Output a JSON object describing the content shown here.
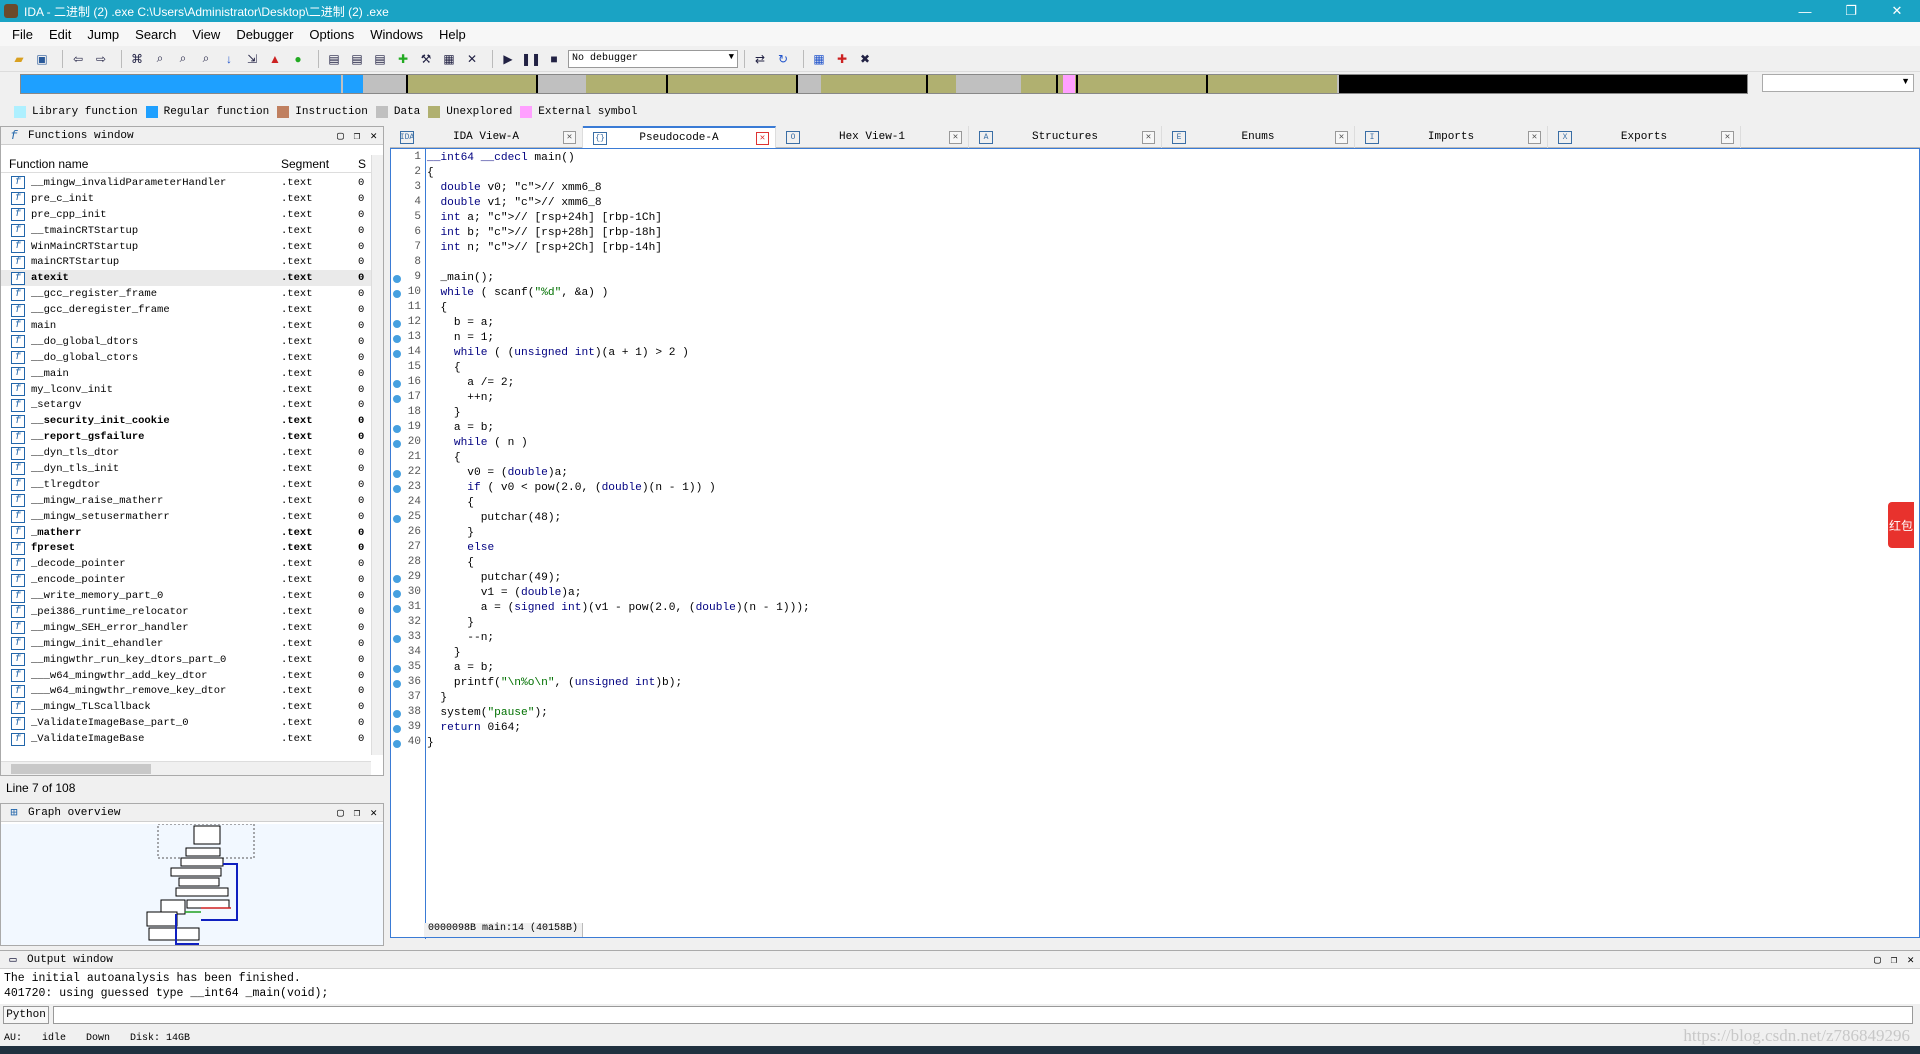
{
  "titlebar": {
    "title": "IDA - 二进制 (2) .exe C:\\Users\\Administrator\\Desktop\\二进制 (2) .exe",
    "min": "—",
    "max": "❐",
    "close": "✕"
  },
  "menu": [
    "File",
    "Edit",
    "Jump",
    "Search",
    "View",
    "Debugger",
    "Options",
    "Windows",
    "Help"
  ],
  "toolbar": {
    "debugger": "No debugger"
  },
  "legend": [
    {
      "label": "Library function",
      "color": "#aef0ff"
    },
    {
      "label": "Regular function",
      "color": "#1ea0ff"
    },
    {
      "label": "Instruction",
      "color": "#c08060"
    },
    {
      "label": "Data",
      "color": "#c0c0c0"
    },
    {
      "label": "Unexplored",
      "color": "#b0b070"
    },
    {
      "label": "External symbol",
      "color": "#ffa0ff"
    }
  ],
  "functions_window": {
    "title": "Functions window",
    "col_name": "Function name",
    "col_segment": "Segment",
    "col_start": "S",
    "rows": [
      {
        "name": "__mingw_invalidParameterHandler",
        "seg": ".text",
        "st": "0",
        "bold": false
      },
      {
        "name": "pre_c_init",
        "seg": ".text",
        "st": "0",
        "bold": false
      },
      {
        "name": "pre_cpp_init",
        "seg": ".text",
        "st": "0",
        "bold": false
      },
      {
        "name": "__tmainCRTStartup",
        "seg": ".text",
        "st": "0",
        "bold": false
      },
      {
        "name": "WinMainCRTStartup",
        "seg": ".text",
        "st": "0",
        "bold": false
      },
      {
        "name": "mainCRTStartup",
        "seg": ".text",
        "st": "0",
        "bold": false
      },
      {
        "name": "atexit",
        "seg": ".text",
        "st": "0",
        "bold": true
      },
      {
        "name": "__gcc_register_frame",
        "seg": ".text",
        "st": "0",
        "bold": false
      },
      {
        "name": "__gcc_deregister_frame",
        "seg": ".text",
        "st": "0",
        "bold": false
      },
      {
        "name": "main",
        "seg": ".text",
        "st": "0",
        "bold": false
      },
      {
        "name": "__do_global_dtors",
        "seg": ".text",
        "st": "0",
        "bold": false
      },
      {
        "name": "__do_global_ctors",
        "seg": ".text",
        "st": "0",
        "bold": false
      },
      {
        "name": "__main",
        "seg": ".text",
        "st": "0",
        "bold": false
      },
      {
        "name": "my_lconv_init",
        "seg": ".text",
        "st": "0",
        "bold": false
      },
      {
        "name": "_setargv",
        "seg": ".text",
        "st": "0",
        "bold": false
      },
      {
        "name": "__security_init_cookie",
        "seg": ".text",
        "st": "0",
        "bold": true
      },
      {
        "name": "__report_gsfailure",
        "seg": ".text",
        "st": "0",
        "bold": true
      },
      {
        "name": "__dyn_tls_dtor",
        "seg": ".text",
        "st": "0",
        "bold": false
      },
      {
        "name": "__dyn_tls_init",
        "seg": ".text",
        "st": "0",
        "bold": false
      },
      {
        "name": "__tlregdtor",
        "seg": ".text",
        "st": "0",
        "bold": false
      },
      {
        "name": "__mingw_raise_matherr",
        "seg": ".text",
        "st": "0",
        "bold": false
      },
      {
        "name": "__mingw_setusermatherr",
        "seg": ".text",
        "st": "0",
        "bold": false
      },
      {
        "name": "_matherr",
        "seg": ".text",
        "st": "0",
        "bold": true
      },
      {
        "name": "fpreset",
        "seg": ".text",
        "st": "0",
        "bold": true
      },
      {
        "name": "_decode_pointer",
        "seg": ".text",
        "st": "0",
        "bold": false
      },
      {
        "name": "_encode_pointer",
        "seg": ".text",
        "st": "0",
        "bold": false
      },
      {
        "name": "__write_memory_part_0",
        "seg": ".text",
        "st": "0",
        "bold": false
      },
      {
        "name": "_pei386_runtime_relocator",
        "seg": ".text",
        "st": "0",
        "bold": false
      },
      {
        "name": "__mingw_SEH_error_handler",
        "seg": ".text",
        "st": "0",
        "bold": false
      },
      {
        "name": "__mingw_init_ehandler",
        "seg": ".text",
        "st": "0",
        "bold": false
      },
      {
        "name": "__mingwthr_run_key_dtors_part_0",
        "seg": ".text",
        "st": "0",
        "bold": false
      },
      {
        "name": "___w64_mingwthr_add_key_dtor",
        "seg": ".text",
        "st": "0",
        "bold": false
      },
      {
        "name": "___w64_mingwthr_remove_key_dtor",
        "seg": ".text",
        "st": "0",
        "bold": false
      },
      {
        "name": "__mingw_TLScallback",
        "seg": ".text",
        "st": "0",
        "bold": false
      },
      {
        "name": "_ValidateImageBase_part_0",
        "seg": ".text",
        "st": "0",
        "bold": false
      },
      {
        "name": "_ValidateImageBase",
        "seg": ".text",
        "st": "0",
        "bold": false
      }
    ]
  },
  "line_count": "Line 7 of 108",
  "graph_overview": {
    "title": "Graph overview"
  },
  "tabs": [
    {
      "label": "IDA View-A",
      "icon": "IDA",
      "active": false
    },
    {
      "label": "Pseudocode-A",
      "icon": "{}",
      "active": true
    },
    {
      "label": "Hex View-1",
      "icon": "O",
      "active": false
    },
    {
      "label": "Structures",
      "icon": "A",
      "active": false
    },
    {
      "label": "Enums",
      "icon": "E",
      "active": false
    },
    {
      "label": "Imports",
      "icon": "I",
      "active": false
    },
    {
      "label": "Exports",
      "icon": "X",
      "active": false
    }
  ],
  "code_lines": [
    {
      "n": "1",
      "dot": false,
      "t": "__int64 __cdecl main()"
    },
    {
      "n": "2",
      "dot": false,
      "t": "{"
    },
    {
      "n": "3",
      "dot": false,
      "t": "  double v0; // xmm6_8"
    },
    {
      "n": "4",
      "dot": false,
      "t": "  double v1; // xmm6_8"
    },
    {
      "n": "5",
      "dot": false,
      "t": "  int a; // [rsp+24h] [rbp-1Ch]"
    },
    {
      "n": "6",
      "dot": false,
      "t": "  int b; // [rsp+28h] [rbp-18h]"
    },
    {
      "n": "7",
      "dot": false,
      "t": "  int n; // [rsp+2Ch] [rbp-14h]"
    },
    {
      "n": "8",
      "dot": false,
      "t": ""
    },
    {
      "n": "9",
      "dot": true,
      "t": "  _main();"
    },
    {
      "n": "10",
      "dot": true,
      "t": "  while ( scanf(\"%d\", &a) )"
    },
    {
      "n": "11",
      "dot": false,
      "t": "  {"
    },
    {
      "n": "12",
      "dot": true,
      "t": "    b = a;"
    },
    {
      "n": "13",
      "dot": true,
      "t": "    n = 1;"
    },
    {
      "n": "14",
      "dot": true,
      "t": "    while ( (unsigned int)(a + 1) > 2 )"
    },
    {
      "n": "15",
      "dot": false,
      "t": "    {"
    },
    {
      "n": "16",
      "dot": true,
      "t": "      a /= 2;"
    },
    {
      "n": "17",
      "dot": true,
      "t": "      ++n;"
    },
    {
      "n": "18",
      "dot": false,
      "t": "    }"
    },
    {
      "n": "19",
      "dot": true,
      "t": "    a = b;"
    },
    {
      "n": "20",
      "dot": true,
      "t": "    while ( n )"
    },
    {
      "n": "21",
      "dot": false,
      "t": "    {"
    },
    {
      "n": "22",
      "dot": true,
      "t": "      v0 = (double)a;"
    },
    {
      "n": "23",
      "dot": true,
      "t": "      if ( v0 < pow(2.0, (double)(n - 1)) )"
    },
    {
      "n": "24",
      "dot": false,
      "t": "      {"
    },
    {
      "n": "25",
      "dot": true,
      "t": "        putchar(48);"
    },
    {
      "n": "26",
      "dot": false,
      "t": "      }"
    },
    {
      "n": "27",
      "dot": false,
      "t": "      else"
    },
    {
      "n": "28",
      "dot": false,
      "t": "      {"
    },
    {
      "n": "29",
      "dot": true,
      "t": "        putchar(49);"
    },
    {
      "n": "30",
      "dot": true,
      "t": "        v1 = (double)a;"
    },
    {
      "n": "31",
      "dot": true,
      "t": "        a = (signed int)(v1 - pow(2.0, (double)(n - 1)));"
    },
    {
      "n": "32",
      "dot": false,
      "t": "      }"
    },
    {
      "n": "33",
      "dot": true,
      "t": "      --n;"
    },
    {
      "n": "34",
      "dot": false,
      "t": "    }"
    },
    {
      "n": "35",
      "dot": true,
      "t": "    a = b;"
    },
    {
      "n": "36",
      "dot": true,
      "t": "    printf(\"\\n%o\\n\", (unsigned int)b);"
    },
    {
      "n": "37",
      "dot": false,
      "t": "  }"
    },
    {
      "n": "38",
      "dot": true,
      "t": "  system(\"pause\");"
    },
    {
      "n": "39",
      "dot": true,
      "t": "  return 0i64;"
    },
    {
      "n": "40",
      "dot": true,
      "t": "}"
    }
  ],
  "code_status": "0000098B main:14 (40158B)",
  "output_window": {
    "title": "Output window",
    "lines": [
      "The initial autoanalysis has been finished.",
      "401720: using guessed type __int64 _main(void);"
    ]
  },
  "python_label": "Python",
  "statusbar": {
    "au": "AU:",
    "state": "idle",
    "dir": "Down",
    "disk": "Disk: 14GB"
  },
  "watermark": "https://blog.csdn.net/z786849296"
}
